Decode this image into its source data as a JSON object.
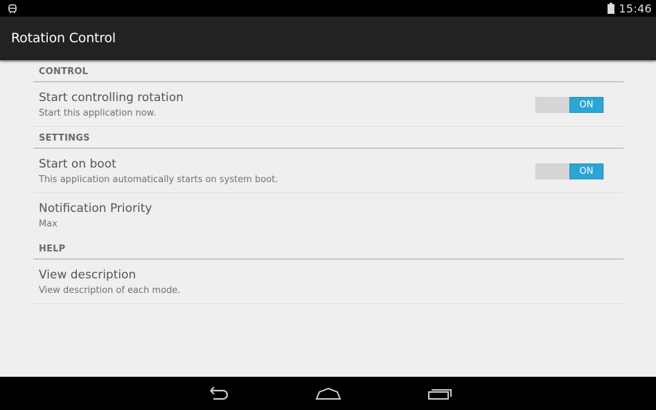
{
  "status_bar": {
    "left_icon": "android-debug-icon",
    "battery_icon": "battery-icon",
    "time": "15:46"
  },
  "action_bar": {
    "title": "Rotation Control"
  },
  "categories": [
    {
      "label": "CONTROL",
      "prefs": [
        {
          "title": "Start controlling rotation",
          "summary": "Start this application now.",
          "switch_label": "ON",
          "switch_on": true
        }
      ]
    },
    {
      "label": "SETTINGS",
      "prefs": [
        {
          "title": "Start on boot",
          "summary": "This application automatically starts on system boot.",
          "switch_label": "ON",
          "switch_on": true
        },
        {
          "title": "Notification Priority",
          "summary": "Max"
        }
      ]
    },
    {
      "label": "HELP",
      "prefs": [
        {
          "title": "View description",
          "summary": "View description of each mode."
        }
      ]
    }
  ],
  "nav_bar": {
    "back_icon": "back-icon",
    "home_icon": "home-icon",
    "recents_icon": "recents-icon"
  },
  "colors": {
    "accent": "#2aa6d4",
    "action_bar": "#222222",
    "background": "#efefef"
  }
}
